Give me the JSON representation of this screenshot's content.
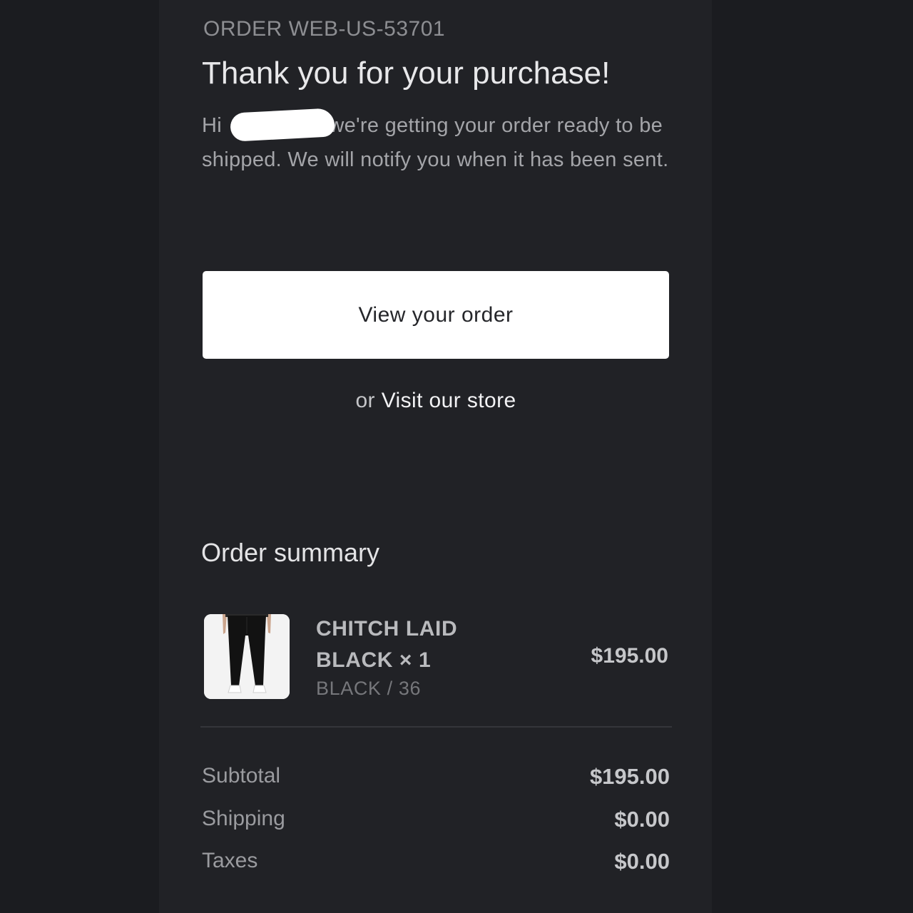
{
  "order": {
    "number_label": "ORDER WEB-US-53701"
  },
  "header": {
    "headline": "Thank you for your purchase!"
  },
  "intro": {
    "greeting": "Hi",
    "message": "we're getting your order ready to be shipped. We will notify you when it has been sent."
  },
  "actions": {
    "view_order_label": "View your order",
    "or_text": "or",
    "visit_store_label": "Visit our store"
  },
  "summary": {
    "title": "Order summary",
    "items": [
      {
        "name": "CHITCH LAID BLACK × 1",
        "variant": "BLACK / 36",
        "price": "$195.00",
        "image_icon": "black-jeans-product-photo"
      }
    ],
    "totals": [
      {
        "label": "Subtotal",
        "value": "$195.00"
      },
      {
        "label": "Shipping",
        "value": "$0.00"
      },
      {
        "label": "Taxes",
        "value": "$0.00"
      }
    ]
  },
  "colors": {
    "background": "#1b1c20",
    "panel": "#212226",
    "button": "#ffffff"
  }
}
